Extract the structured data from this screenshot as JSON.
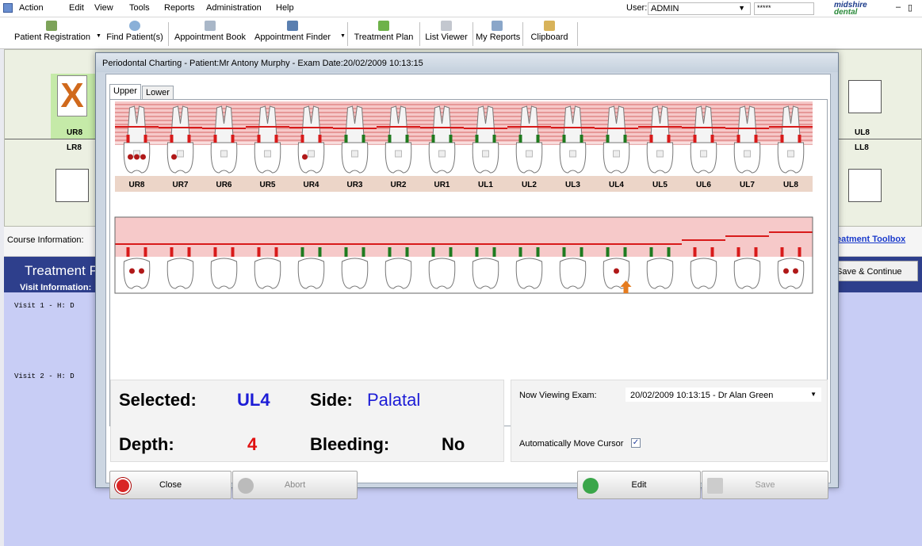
{
  "menubar": {
    "items": [
      "Action",
      "Edit",
      "View",
      "Tools",
      "Reports",
      "Administration",
      "Help"
    ],
    "user_label": "User:",
    "user_value": "ADMIN",
    "password_mask": "*****",
    "logo_top": "midshire",
    "logo_bottom": "dental"
  },
  "toolbar": {
    "items": [
      "Patient Registration",
      "Find Patient(s)",
      "Appointment Book",
      "Appointment Finder",
      "Treatment Plan",
      "List Viewer",
      "My Reports",
      "Clipboard"
    ]
  },
  "background": {
    "left_upper_label": "UR8",
    "left_lower_label": "LR8",
    "right_upper_label": "UL8",
    "right_lower_label": "LL8",
    "course_label": "Course Information:",
    "toolbox_link": "eatment Toolbox",
    "treatment_title": "Treatment P",
    "visit_info": "Visit Information:",
    "visit1": "Visit 1 - H: D",
    "visit2": "Visit 2 - H: D",
    "save_continue": "Save & Continue"
  },
  "dialog": {
    "title": "Periodontal Charting - Patient:Mr Antony Murphy - Exam Date:20/02/2009 10:13:15",
    "tabs": [
      "Upper",
      "Lower"
    ],
    "upper_teeth": [
      "UR8",
      "UR7",
      "UR6",
      "UR5",
      "UR4",
      "UR3",
      "UR2",
      "UR1",
      "UL1",
      "UL2",
      "UL3",
      "UL4",
      "UL5",
      "UL6",
      "UL7",
      "UL8"
    ],
    "info": {
      "selected_label": "Selected:",
      "selected_value": "UL4",
      "side_label": "Side:",
      "side_value": "Palatal",
      "depth_label": "Depth:",
      "depth_value": "4",
      "bleeding_label": "Bleeding:",
      "bleeding_value": "No"
    },
    "viewing": {
      "label": "Now Viewing Exam:",
      "value": "20/02/2009 10:13:15 - Dr Alan Green",
      "auto_move_label": "Automatically Move Cursor",
      "auto_move_checked": true
    },
    "buttons": {
      "close": "Close",
      "abort": "Abort",
      "edit": "Edit",
      "save": "Save"
    }
  },
  "colors": {
    "accent_blue": "#1c1cd6",
    "depth_red": "#e01010",
    "gum_pink": "#f6c9c9",
    "label_strip": "#ecd5c8"
  }
}
